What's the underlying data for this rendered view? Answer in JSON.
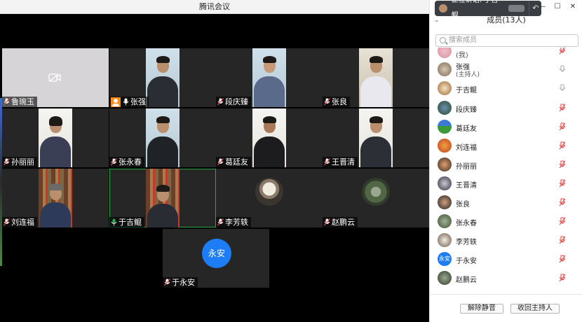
{
  "window_title": "腾讯会议",
  "speaker_toast": {
    "prefix": "正在讲话: 于吉鲲",
    "action_icon": "undo-icon"
  },
  "window_controls": [
    "—",
    "☐",
    "✕"
  ],
  "panel": {
    "title": "成员(13人)",
    "search_placeholder": "搜索成员",
    "footer": {
      "unmute_all": "解除静音",
      "reclaim_host": "收回主持人"
    }
  },
  "tiles": [
    {
      "name": "鲁琬玉",
      "state": "camera-off"
    },
    {
      "name": "张强",
      "state": "video",
      "host": true
    },
    {
      "name": "段庆臻",
      "state": "video"
    },
    {
      "name": "张良",
      "state": "video"
    },
    {
      "name": "孙丽丽",
      "state": "video"
    },
    {
      "name": "张永春",
      "state": "video"
    },
    {
      "name": "葛廷友",
      "state": "video"
    },
    {
      "name": "王晋清",
      "state": "video"
    },
    {
      "name": "刘连福",
      "state": "video"
    },
    {
      "name": "于吉鲲",
      "state": "video",
      "speaking": true
    },
    {
      "name": "李芳轶",
      "state": "avatar"
    },
    {
      "name": "赵鹏云",
      "state": "avatar"
    },
    {
      "name": "于永安",
      "state": "avatar",
      "avatar_text": "永安"
    }
  ],
  "members": [
    {
      "name": "(我)",
      "sub": "",
      "mic": "muted"
    },
    {
      "name": "张强",
      "sub": "(主持人)",
      "mic": "on"
    },
    {
      "name": "于吉鲲",
      "sub": "",
      "mic": "on"
    },
    {
      "name": "段庆臻",
      "sub": "",
      "mic": "muted"
    },
    {
      "name": "葛廷友",
      "sub": "",
      "mic": "muted"
    },
    {
      "name": "刘连福",
      "sub": "",
      "mic": "muted"
    },
    {
      "name": "孙丽丽",
      "sub": "",
      "mic": "muted"
    },
    {
      "name": "王晋清",
      "sub": "",
      "mic": "muted"
    },
    {
      "name": "张良",
      "sub": "",
      "mic": "muted"
    },
    {
      "name": "张永春",
      "sub": "",
      "mic": "muted"
    },
    {
      "name": "李芳轶",
      "sub": "",
      "mic": "muted"
    },
    {
      "name": "于永安",
      "sub": "",
      "mic": "muted",
      "avatar_text": "永安"
    },
    {
      "name": "赵鹏云",
      "sub": "",
      "mic": "muted"
    }
  ],
  "colors": {
    "accent": "#1e7cf5",
    "host_badge": "#ff8c1a",
    "speaking_border": "#2aa84a",
    "muted_mic": "#e84d4d"
  }
}
